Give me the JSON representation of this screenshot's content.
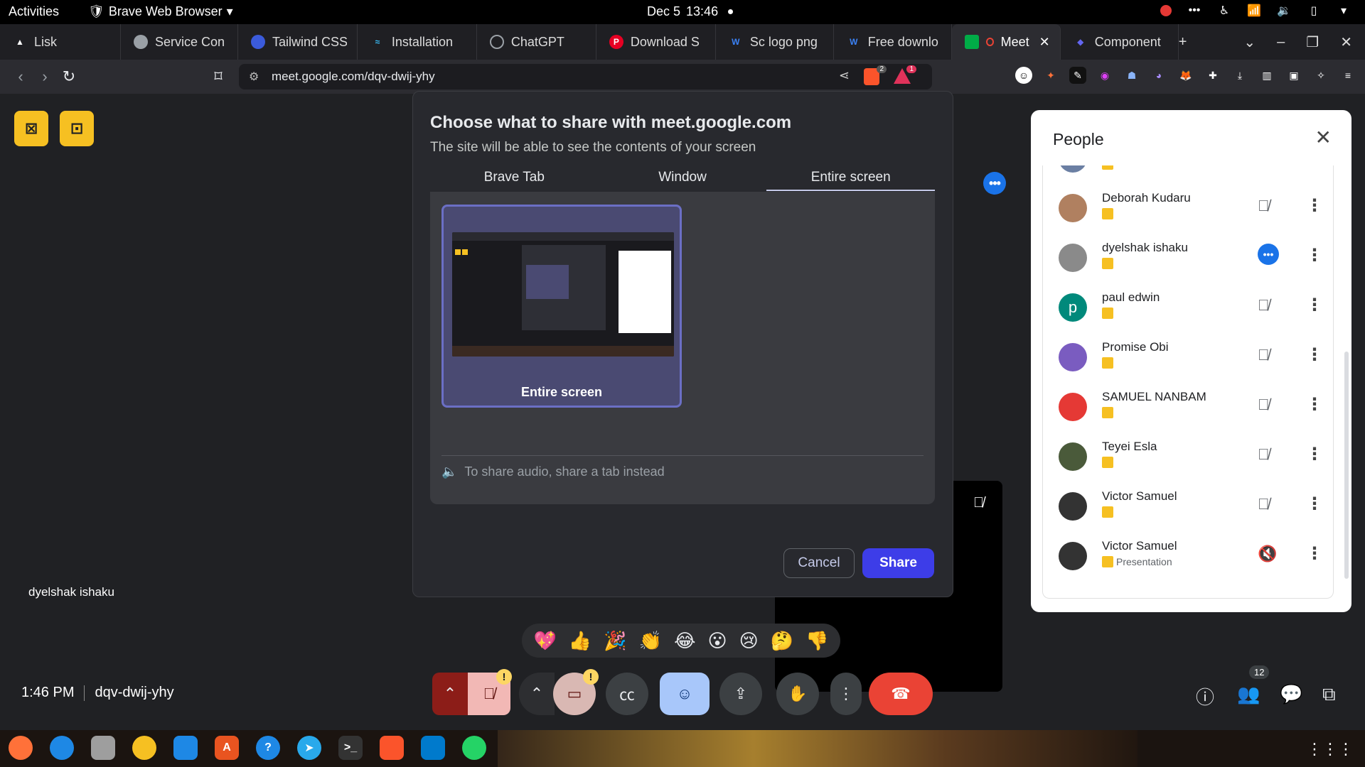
{
  "topbar": {
    "activities": "Activities",
    "app_name": "Brave Web Browser",
    "date": "Dec 5",
    "time": "13:46"
  },
  "tabs": [
    {
      "label": "Lisk",
      "favicon_color": "#ffffff"
    },
    {
      "label": "Service Con",
      "favicon_color": "#9aa0a6"
    },
    {
      "label": "Tailwind CSS",
      "favicon_color": "#3b5bdb"
    },
    {
      "label": "Installation",
      "favicon_color": "#38bdf8"
    },
    {
      "label": "ChatGPT",
      "favicon_color": "#9aa0a6"
    },
    {
      "label": "Download S",
      "favicon_color": "#e60023"
    },
    {
      "label": "Sc logo png",
      "favicon_color": "#3b82f6"
    },
    {
      "label": "Free downlo",
      "favicon_color": "#3b82f6"
    },
    {
      "label": "Meet -",
      "favicon_color": "#00ac47",
      "active": true
    },
    {
      "label": "Component",
      "favicon_color": "#6366f1"
    }
  ],
  "url": "meet.google.com/dqv-dwij-yhy",
  "brave_badge": "2",
  "rewards_badge": "1",
  "share_dialog": {
    "title": "Choose what to share with meet.google.com",
    "subtitle": "The site will be able to see the contents of your screen",
    "tabs": [
      "Brave Tab",
      "Window",
      "Entire screen"
    ],
    "active_tab": "Entire screen",
    "screen_label": "Entire screen",
    "audio_note": "To share audio, share a tab instead",
    "cancel": "Cancel",
    "share": "Share"
  },
  "people_panel": {
    "title": "People",
    "participants": [
      {
        "name": "",
        "badge": "",
        "avatar_color": "#6b7fa3",
        "mic": "muted"
      },
      {
        "name": "Deborah Kudaru",
        "badge": "",
        "avatar_color": "#b08060",
        "mic": "muted"
      },
      {
        "name": "dyelshak ishaku",
        "badge": "",
        "avatar_color": "#8a8a8a",
        "mic": "more"
      },
      {
        "name": "paul edwin",
        "badge": "",
        "avatar_letter": "p",
        "avatar_color": "#00897b",
        "mic": "muted"
      },
      {
        "name": "Promise Obi",
        "badge": "",
        "avatar_color": "#7a5cc0",
        "mic": "muted"
      },
      {
        "name": "SAMUEL NANBAM",
        "badge": "",
        "avatar_color": "#e53935",
        "mic": "muted"
      },
      {
        "name": "Teyei Esla",
        "badge": "",
        "avatar_color": "#4a5a3a",
        "mic": "muted"
      },
      {
        "name": "Victor Samuel",
        "badge": "",
        "avatar_color": "#333333",
        "mic": "muted"
      },
      {
        "name": "Victor Samuel",
        "badge": "Presentation",
        "avatar_color": "#333333",
        "mic": "off"
      }
    ]
  },
  "self_name": "dyelshak ishaku",
  "reactions": [
    "💖",
    "👍",
    "🎉",
    "👏",
    "😂",
    "😮",
    "😢",
    "🤔",
    "👎"
  ],
  "meeting": {
    "time": "1:46 PM",
    "code": "dqv-dwij-yhy",
    "people_count": "12"
  },
  "colors": {
    "accent_blue": "#1a73e8",
    "share_button": "#3d3de8",
    "end_call": "#ea4335",
    "yellow": "#f6c022"
  }
}
